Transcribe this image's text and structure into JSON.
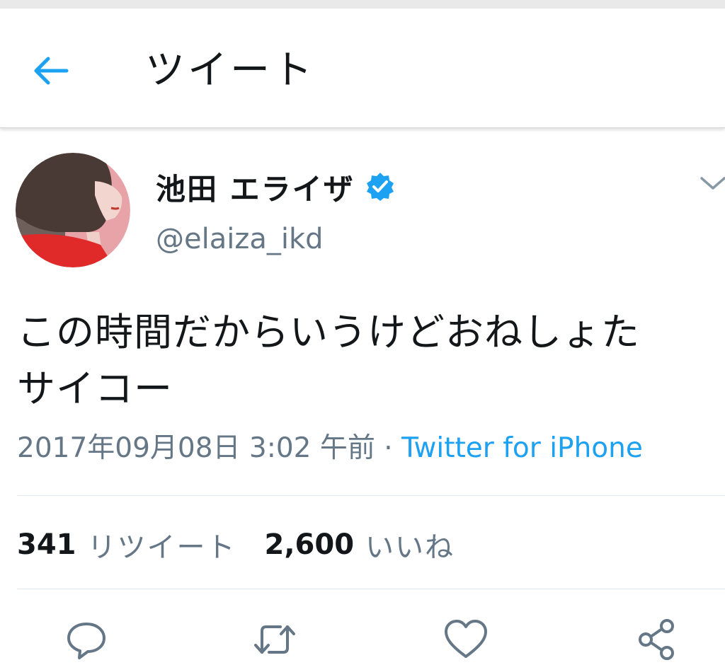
{
  "header": {
    "title": "ツイート",
    "back_icon": "back-arrow-icon"
  },
  "tweet": {
    "author": {
      "display_name": "池田 エライザ",
      "handle": "@elaiza_ikd",
      "verified": true
    },
    "text_lines": [
      "この時間だからいうけどおねしょた",
      "サイコー"
    ],
    "timestamp": "2017年09月08日 3:02 午前",
    "separator": " · ",
    "source": "Twitter for iPhone",
    "stats": {
      "retweet_count": "341",
      "retweet_label": "リツイート",
      "like_count": "2,600",
      "like_label": "いいね"
    }
  },
  "actions": [
    "reply-icon",
    "retweet-icon",
    "like-icon",
    "share-icon"
  ],
  "colors": {
    "accent": "#1da1f2",
    "muted_text": "#657786",
    "primary_text": "#14171a",
    "divider": "#e1e8ed"
  }
}
